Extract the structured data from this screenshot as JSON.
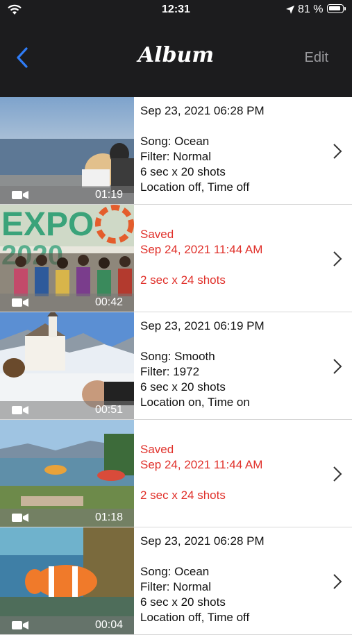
{
  "status_bar": {
    "time": "12:31",
    "battery": "81 %"
  },
  "nav": {
    "title": "Album",
    "edit_label": "Edit",
    "back_icon": "chevron-left-icon"
  },
  "colors": {
    "header_bg": "#1c1c1e",
    "back_blue": "#2f7cf6",
    "saved_red": "#e0302a"
  },
  "rows": [
    {
      "duration": "01:19",
      "saved": false,
      "date": "Sep 23, 2021 06:28 PM",
      "song": "Song: Ocean",
      "filter": "Filter: Normal",
      "shots": "6 sec x 20 shots",
      "loc_time": "Location off, Time off"
    },
    {
      "duration": "00:42",
      "saved": true,
      "saved_label": "Saved",
      "date": "Sep 24, 2021 11:44 AM",
      "shots": "2 sec x 24 shots"
    },
    {
      "duration": "00:51",
      "saved": false,
      "date": "Sep 23, 2021 06:19 PM",
      "song": "Song: Smooth",
      "filter": "Filter: 1972",
      "shots": "6 sec x 20 shots",
      "loc_time": "Location on, Time on"
    },
    {
      "duration": "01:18",
      "saved": true,
      "saved_label": "Saved",
      "date": "Sep 24, 2021 11:44 AM",
      "shots": "2 sec x 24 shots"
    },
    {
      "duration": "00:04",
      "saved": false,
      "date": "Sep 23, 2021 06:28 PM",
      "song": "Song: Ocean",
      "filter": "Filter: Normal",
      "shots": "6 sec x 20 shots",
      "loc_time": "Location off, Time off"
    }
  ]
}
